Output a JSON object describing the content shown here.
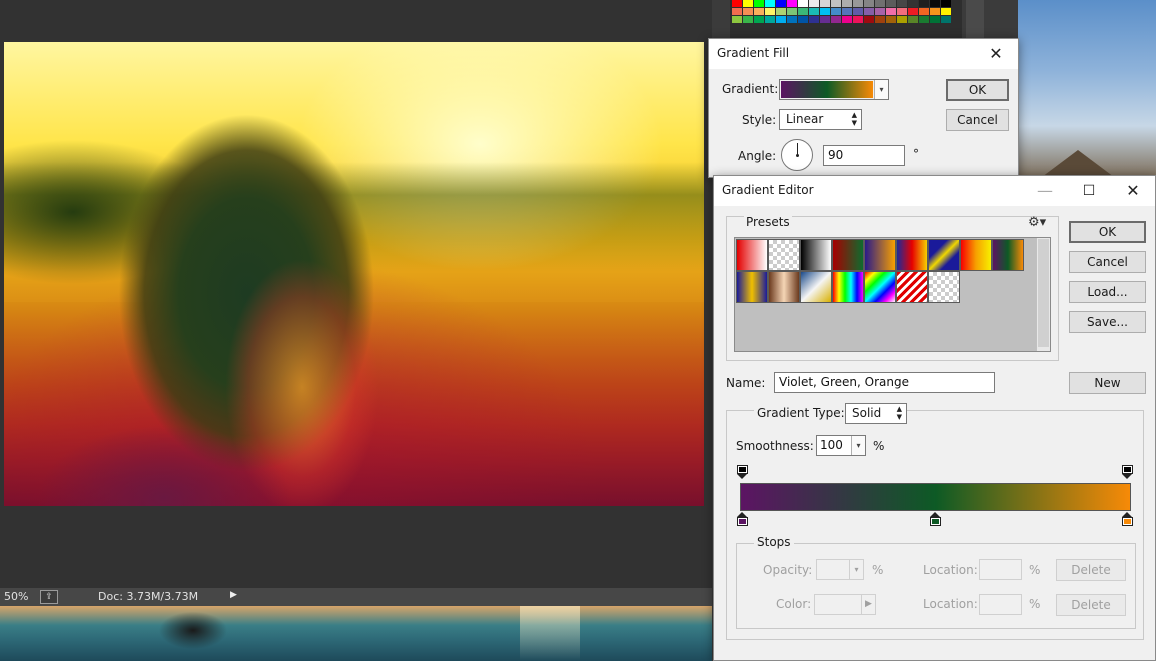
{
  "status_bar": {
    "zoom": "50%",
    "doc": "Doc: 3.73M/3.73M",
    "share_icon": "export-icon",
    "arrow_icon": "play-triangle-icon"
  },
  "swatch_colors": [
    "#ff0000",
    "#ffff00",
    "#00ff00",
    "#00ffff",
    "#0000ff",
    "#ff00ff",
    "#ffffff",
    "#ebebeb",
    "#d6d6d6",
    "#c2c2c2",
    "#adadad",
    "#999999",
    "#858585",
    "#707070",
    "#5c5c5c",
    "#474747",
    "#333333",
    "#1f1f1f",
    "#0a0a0a",
    "#000000",
    "#f26c4f",
    "#f68e55",
    "#fbaf5c",
    "#fff467",
    "#acd372",
    "#7cc576",
    "#3bb878",
    "#1abbb4",
    "#00bff3",
    "#438cca",
    "#5574b9",
    "#605ca8",
    "#855fa8",
    "#a763a8",
    "#f06ea9",
    "#f26d7d",
    "#ed1c24",
    "#f26522",
    "#f7941d",
    "#fff200",
    "#8dc63f",
    "#39b54a",
    "#00a651",
    "#00a99d",
    "#00aeef",
    "#0072bc",
    "#0054a6",
    "#2e3192",
    "#662d91",
    "#92278f",
    "#ec008c",
    "#ed145b",
    "#9e0b0f",
    "#a0410d",
    "#a36209",
    "#aba000",
    "#598527",
    "#1a7b30",
    "#007236",
    "#00746b"
  ],
  "gradient_fill": {
    "title": "Gradient Fill",
    "gradient_label": "Gradient:",
    "style_label": "Style:",
    "style_value": "Linear",
    "angle_label": "Angle:",
    "angle_value": "90",
    "degree_symbol": "°",
    "ok": "OK",
    "cancel": "Cancel"
  },
  "gradient_editor": {
    "title": "Gradient Editor",
    "presets_label": "Presets",
    "presets_gear_icon": "gear-icon",
    "ok": "OK",
    "cancel": "Cancel",
    "load": "Load...",
    "save": "Save...",
    "name_label": "Name:",
    "name_value": "Violet, Green, Orange",
    "new": "New",
    "gradient_type_label": "Gradient Type:",
    "gradient_type_value": "Solid",
    "smoothness_label": "Smoothness:",
    "smoothness_value": "100",
    "percent": "%",
    "colors": {
      "violet": "#5c1463",
      "green": "#0d5a25",
      "orange": "#f78a07"
    },
    "stops": {
      "label": "Stops",
      "opacity_label": "Opacity:",
      "location_label": "Location:",
      "color_label": "Color:",
      "percent": "%",
      "delete": "Delete"
    },
    "presets": [
      "linear-gradient(90deg,#e30000,#fff)",
      "repeating-conic-gradient(#ccc 0 25%,#fff 0 50%) 0 0/8px 8px",
      "linear-gradient(90deg,#000,#fff)",
      "linear-gradient(90deg,#a80000,#0e6b2e)",
      "linear-gradient(90deg,#2a1a8a,#f7a000)",
      "linear-gradient(90deg,#1c2a9a,#e60000,#f7d000)",
      "linear-gradient(135deg,#1a1a9a 0%,#1a1a9a 30%,#f0d800 50%,#1a1a9a 70%,#1a1a9a 100%)",
      "linear-gradient(90deg,#f80000,#f7a000,#f7f000)",
      "linear-gradient(90deg,#5c1463,#0d5a25,#f78a07)",
      "linear-gradient(90deg,#1a1a9a,#f0c000,#1a1a9a)",
      "linear-gradient(90deg,#6b3a1e,#f5d5b5,#6b3a1e)",
      "linear-gradient(135deg,#1a4a8a,#f5f5f5 50%,#d8b000)",
      "linear-gradient(90deg,#f00,#ff0,#0f0,#0ff,#00f,#f0f)",
      "linear-gradient(135deg,#f00,#ff0,#0f0,#0ff,#00f,#f0f,#fff)",
      "repeating-linear-gradient(135deg,#e00000 0 3px,#fff 3px 6px)",
      "repeating-conic-gradient(#ccc 0 25%,#fff 0 50%) 0 0/8px 8px"
    ]
  }
}
